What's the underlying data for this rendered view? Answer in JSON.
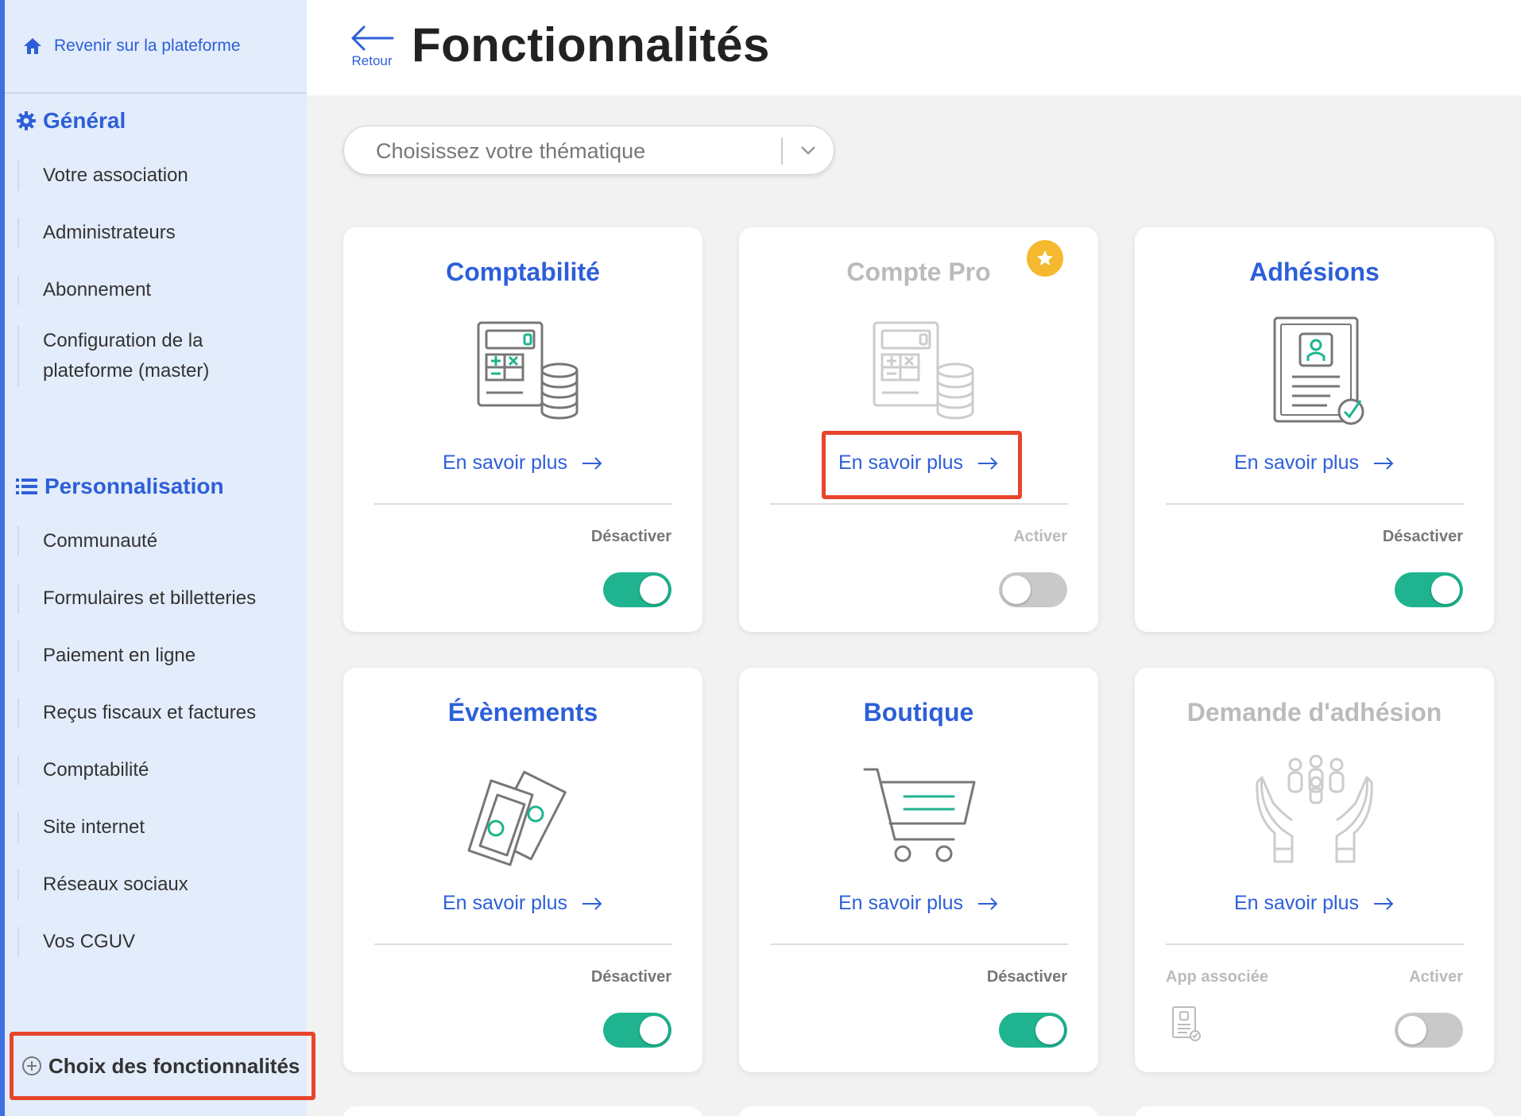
{
  "sidebar": {
    "back_label": "Revenir sur la plateforme",
    "general_title": "Général",
    "general_items": [
      "Votre association",
      "Administrateurs",
      "Abonnement",
      "Configuration de la",
      "plateforme (master)"
    ],
    "perso_title": "Personnalisation",
    "perso_items": [
      "Communauté",
      "Formulaires et billetteries",
      "Paiement en ligne",
      "Reçus fiscaux et factures",
      "Comptabilité",
      "Site internet",
      "Réseaux sociaux",
      "Vos CGUV"
    ],
    "feature_choice": "Choix des fonctionnalités"
  },
  "header": {
    "back_label": "Retour",
    "title": "Fonctionnalités"
  },
  "theme_select": {
    "placeholder": "Choisissez votre thématique"
  },
  "cards": [
    {
      "title": "Comptabilité",
      "learn_more": "En savoir plus",
      "state_label": "Désactiver",
      "enabled": true
    },
    {
      "title": "Compte Pro",
      "learn_more": "En savoir plus",
      "state_label": "Activer",
      "enabled": false
    },
    {
      "title": "Adhésions",
      "learn_more": "En savoir plus",
      "state_label": "Désactiver",
      "enabled": true
    },
    {
      "title": "Évènements",
      "learn_more": "En savoir plus",
      "state_label": "Désactiver",
      "enabled": true
    },
    {
      "title": "Boutique",
      "learn_more": "En savoir plus",
      "state_label": "Désactiver",
      "enabled": true
    },
    {
      "title": "Demande d'adhésion",
      "learn_more": "En savoir plus",
      "state_label": "Activer",
      "app_label": "App associée",
      "enabled": false
    }
  ],
  "colors": {
    "accent": "#2d5fd8",
    "toggle_on": "#1fb48f",
    "highlight": "#e8452c",
    "star": "#f5b82e"
  }
}
